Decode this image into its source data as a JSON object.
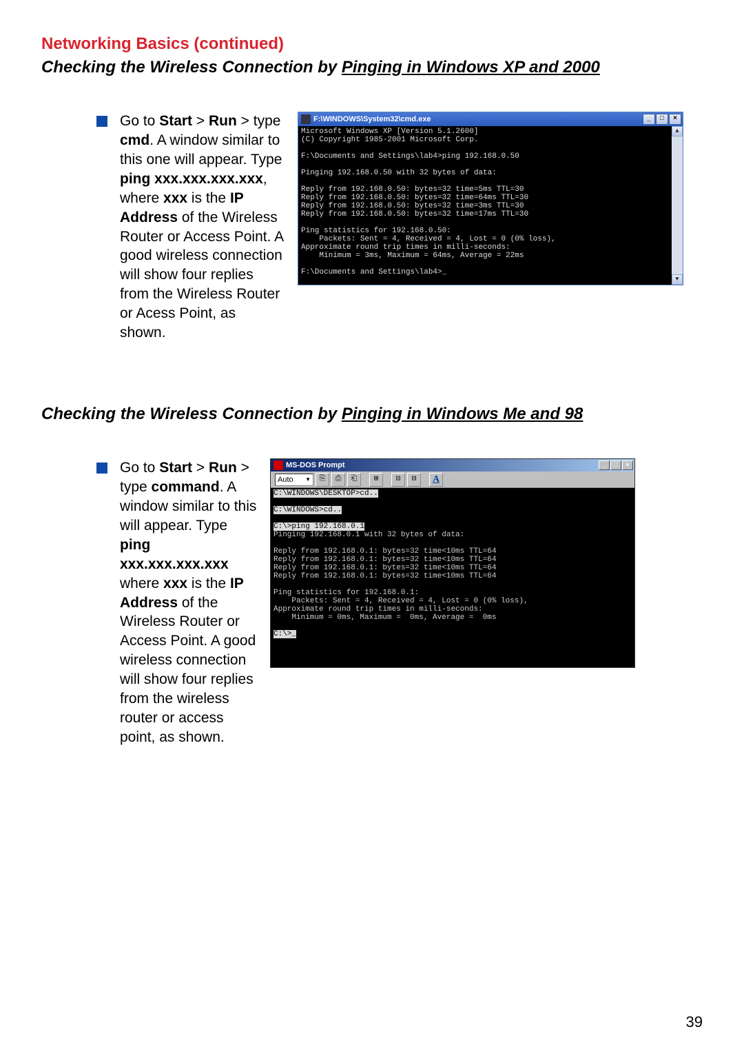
{
  "section_title": "Networking Basics (continued)",
  "sub1_prefix": "Checking the Wireless Connection by ",
  "sub1_underline": "Pinging in Windows XP and 2000",
  "sub2_prefix": "Checking the Wireless Connection by ",
  "sub2_underline": "Pinging in Windows Me and 98",
  "instr1": {
    "p1": "Go to ",
    "b1": "Start",
    "p2": " > ",
    "b2": "Run",
    "p3": " > type ",
    "b3": "cmd",
    "p4": ".  A window similar to this one will appear.  Type ",
    "b4": "ping xxx.xxx.xxx.xxx",
    "p5": ", where ",
    "b5": "xxx",
    "p6": " is the ",
    "b6": "IP Address",
    "p7": " of the Wireless Router or Access Point.  A good wireless connection will show four replies from the Wireless Router or Acess Point, as shown."
  },
  "instr2": {
    "p1": "Go to ",
    "b1": "Start",
    "p2": " > ",
    "b2": "Run",
    "p3": " > type ",
    "b3": "command",
    "p4": ".  A window similar to this will appear.  Type ",
    "b4": "ping xxx.xxx.xxx.xxx",
    "p5": " where ",
    "b5": "xxx",
    "p6": " is the ",
    "b6": "IP Address",
    "p7": " of the Wireless Router or Access Point.  A good wireless connection will show four replies from the wireless router or access point, as shown."
  },
  "cmd1": {
    "title": "F:\\WINDOWS\\System32\\cmd.exe",
    "min": "_",
    "max": "□",
    "close": "×",
    "up": "▲",
    "down": "▼",
    "text": "Microsoft Windows XP [Version 5.1.2600]\n(C) Copyright 1985-2001 Microsoft Corp.\n\nF:\\Documents and Settings\\lab4>ping 192.168.0.50\n\nPinging 192.168.0.50 with 32 bytes of data:\n\nReply from 192.168.0.50: bytes=32 time=5ms TTL=30\nReply from 192.168.0.50: bytes=32 time=64ms TTL=30\nReply from 192.168.0.50: bytes=32 time=3ms TTL=30\nReply from 192.168.0.50: bytes=32 time=17ms TTL=30\n\nPing statistics for 192.168.0.50:\n    Packets: Sent = 4, Received = 4, Lost = 0 (0% loss),\nApproximate round trip times in milli-seconds:\n    Minimum = 3ms, Maximum = 64ms, Average = 22ms\n\nF:\\Documents and Settings\\lab4>_"
  },
  "cmd2": {
    "title": "MS-DOS Prompt",
    "min": "_",
    "max": "□",
    "close": "×",
    "sel": "Auto",
    "tb1": "⎘",
    "tb2": "⎙",
    "tb3": "⎗",
    "tb4": "⊞",
    "tb5": "⊡",
    "tb6": "⊟",
    "tbA": "A",
    "hl1": "C:\\WINDOWS\\DESKTOP>cd..",
    "hl2": "C:\\WINDOWS>cd..",
    "hl3": "C:\\>ping 192.168.0.1",
    "body": "\nPinging 192.168.0.1 with 32 bytes of data:\n\nReply from 192.168.0.1: bytes=32 time<10ms TTL=64\nReply from 192.168.0.1: bytes=32 time<10ms TTL=64\nReply from 192.168.0.1: bytes=32 time<10ms TTL=64\nReply from 192.168.0.1: bytes=32 time<10ms TTL=64\n\nPing statistics for 192.168.0.1:\n    Packets: Sent = 4, Received = 4, Lost = 0 (0% loss),\nApproximate round trip times in milli-seconds:\n    Minimum = 0ms, Maximum =  0ms, Average =  0ms\n",
    "hl4": "C:\\>_"
  },
  "page_number": "39"
}
